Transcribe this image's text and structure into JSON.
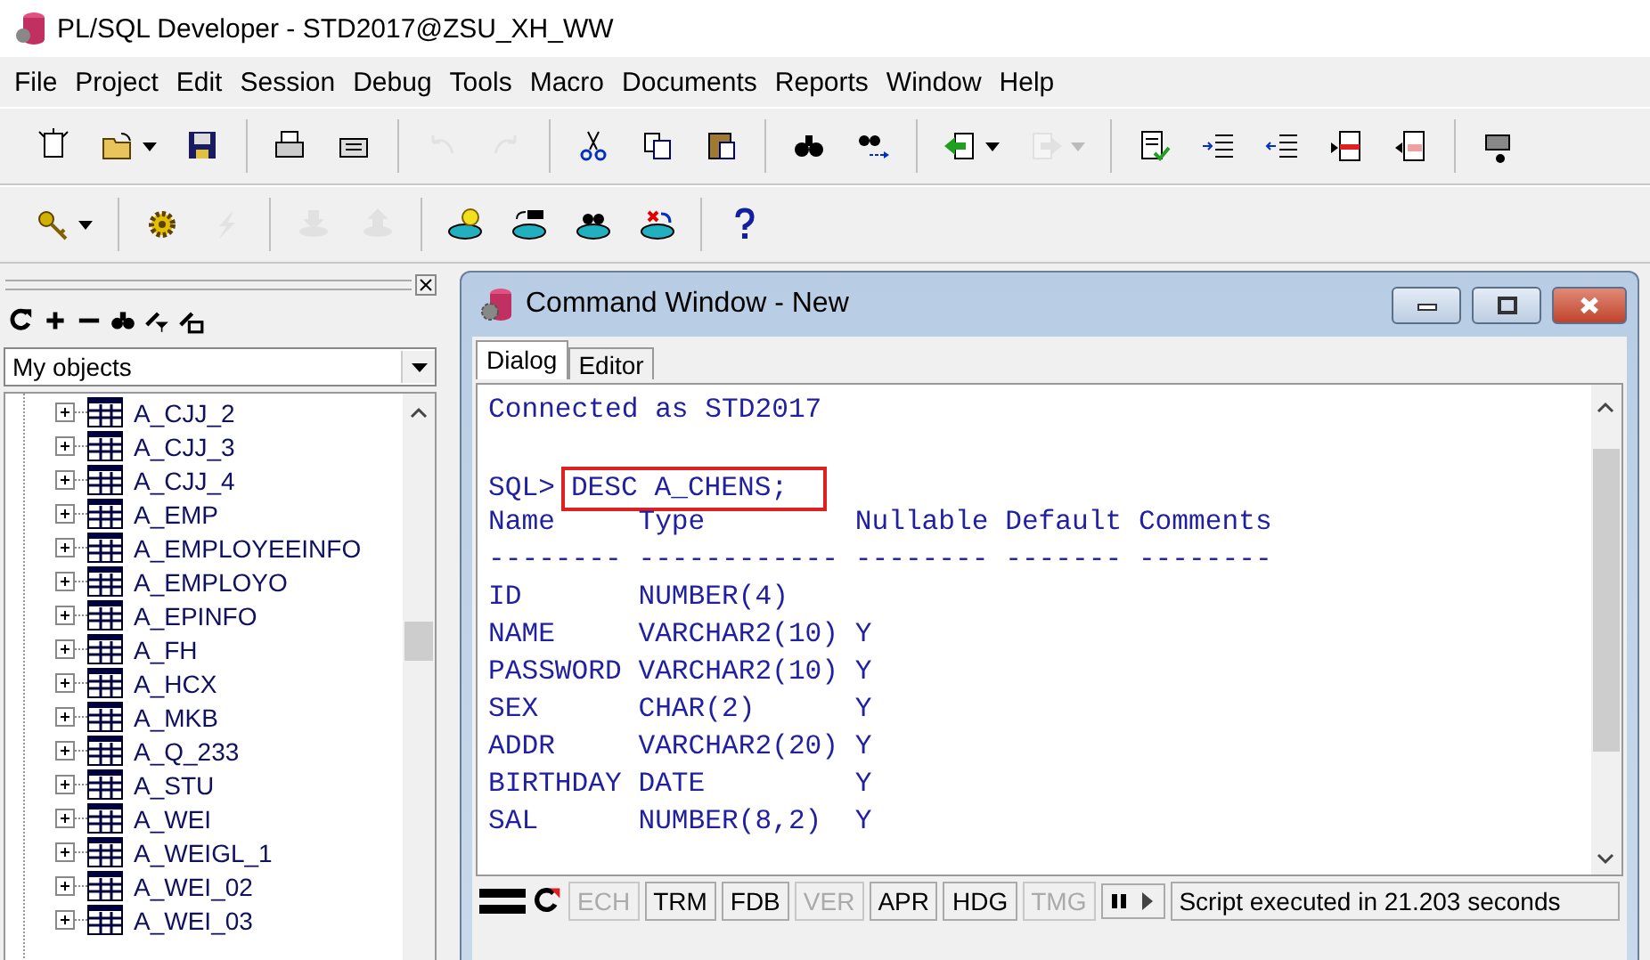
{
  "window": {
    "title": "PL/SQL Developer - STD2017@ZSU_XH_WW"
  },
  "menu": [
    "File",
    "Project",
    "Edit",
    "Session",
    "Debug",
    "Tools",
    "Macro",
    "Documents",
    "Reports",
    "Window",
    "Help"
  ],
  "toolbar_main": [
    [
      {
        "kind": "new",
        "disabled": false
      },
      {
        "kind": "open",
        "disabled": false,
        "has_menu": true
      },
      {
        "kind": "save",
        "disabled": false
      }
    ],
    [
      {
        "kind": "print",
        "disabled": false
      },
      {
        "kind": "print-setup",
        "disabled": false
      }
    ],
    [
      {
        "kind": "undo",
        "disabled": true
      },
      {
        "kind": "redo",
        "disabled": true
      }
    ],
    [
      {
        "kind": "cut",
        "disabled": false
      },
      {
        "kind": "copy",
        "disabled": false
      },
      {
        "kind": "paste",
        "disabled": false
      }
    ],
    [
      {
        "kind": "find",
        "disabled": false
      },
      {
        "kind": "find-next",
        "disabled": false
      }
    ],
    [
      {
        "kind": "back",
        "disabled": false,
        "has_menu": true
      },
      {
        "kind": "forward",
        "disabled": true,
        "has_menu": true
      }
    ],
    [
      {
        "kind": "check",
        "disabled": false
      },
      {
        "kind": "indent",
        "disabled": false
      },
      {
        "kind": "unindent",
        "disabled": false
      },
      {
        "kind": "comment",
        "disabled": false
      },
      {
        "kind": "uncomment",
        "disabled": false
      }
    ],
    [
      {
        "kind": "camera",
        "disabled": false
      }
    ]
  ],
  "toolbar_session": [
    [
      {
        "kind": "key",
        "disabled": false,
        "has_menu": true
      }
    ],
    [
      {
        "kind": "gear",
        "disabled": false
      },
      {
        "kind": "lightning",
        "disabled": true
      }
    ],
    [
      {
        "kind": "download",
        "disabled": true
      },
      {
        "kind": "upload",
        "disabled": true
      }
    ],
    [
      {
        "kind": "db-bulb",
        "disabled": false
      },
      {
        "kind": "db-sql",
        "disabled": false
      },
      {
        "kind": "db-find",
        "disabled": false
      },
      {
        "kind": "db-cancel",
        "disabled": false
      }
    ],
    [
      {
        "kind": "help",
        "disabled": false
      }
    ]
  ],
  "object_browser": {
    "tools": [
      {
        "kind": "refresh"
      },
      {
        "kind": "add"
      },
      {
        "kind": "remove"
      },
      {
        "kind": "find"
      },
      {
        "kind": "filter"
      },
      {
        "kind": "filter-edit"
      }
    ],
    "filter": "My objects",
    "items": [
      {
        "label": "A_CJJ_2",
        "expanded": false
      },
      {
        "label": "A_CJJ_3",
        "expanded": false
      },
      {
        "label": "A_CJJ_4",
        "expanded": false
      },
      {
        "label": "A_EMP",
        "expanded": false
      },
      {
        "label": "A_EMPLOYEEINFO",
        "expanded": false
      },
      {
        "label": "A_EMPLOYO",
        "expanded": false
      },
      {
        "label": "A_EPINFO",
        "expanded": false
      },
      {
        "label": "A_FH",
        "expanded": false
      },
      {
        "label": "A_HCX",
        "expanded": false
      },
      {
        "label": "A_MKB",
        "expanded": false
      },
      {
        "label": "A_Q_233",
        "expanded": false
      },
      {
        "label": "A_STU",
        "expanded": false
      },
      {
        "label": "A_WEI",
        "expanded": false
      },
      {
        "label": "A_WEIGL_1",
        "expanded": false
      },
      {
        "label": "A_WEI_02",
        "expanded": false
      },
      {
        "label": "A_WEI_03",
        "expanded": false
      }
    ]
  },
  "command_window": {
    "title": "Command Window - New",
    "tabs": [
      {
        "label": "Dialog",
        "selected": true
      },
      {
        "label": "Editor",
        "selected": false
      }
    ],
    "lines": [
      {
        "kind": "text",
        "text": "Connected as STD2017"
      },
      {
        "kind": "blank"
      },
      {
        "kind": "command",
        "prompt": "SQL>",
        "text": "DESC A_CHENS;",
        "highlighted": true
      },
      {
        "kind": "text",
        "text": "Name     Type         Nullable Default Comments"
      },
      {
        "kind": "text",
        "text": "-------- ------------ -------- ------- --------"
      },
      {
        "kind": "text",
        "text": "ID       NUMBER(4)"
      },
      {
        "kind": "text",
        "text": "NAME     VARCHAR2(10) Y"
      },
      {
        "kind": "text",
        "text": "PASSWORD VARCHAR2(10) Y"
      },
      {
        "kind": "text",
        "text": "SEX      CHAR(2)      Y"
      },
      {
        "kind": "text",
        "text": "ADDR     VARCHAR2(20) Y"
      },
      {
        "kind": "text",
        "text": "BIRTHDAY DATE         Y"
      },
      {
        "kind": "text",
        "text": "SAL      NUMBER(8,2)  Y"
      }
    ],
    "toggles": [
      {
        "label": "ECH",
        "enabled": false
      },
      {
        "label": "TRM",
        "enabled": true
      },
      {
        "label": "FDB",
        "enabled": true
      },
      {
        "label": "VER",
        "enabled": false
      },
      {
        "label": "APR",
        "enabled": true
      },
      {
        "label": "HDG",
        "enabled": true
      },
      {
        "label": "TMG",
        "enabled": false
      }
    ],
    "status": "Script executed in 21.203 seconds"
  }
}
